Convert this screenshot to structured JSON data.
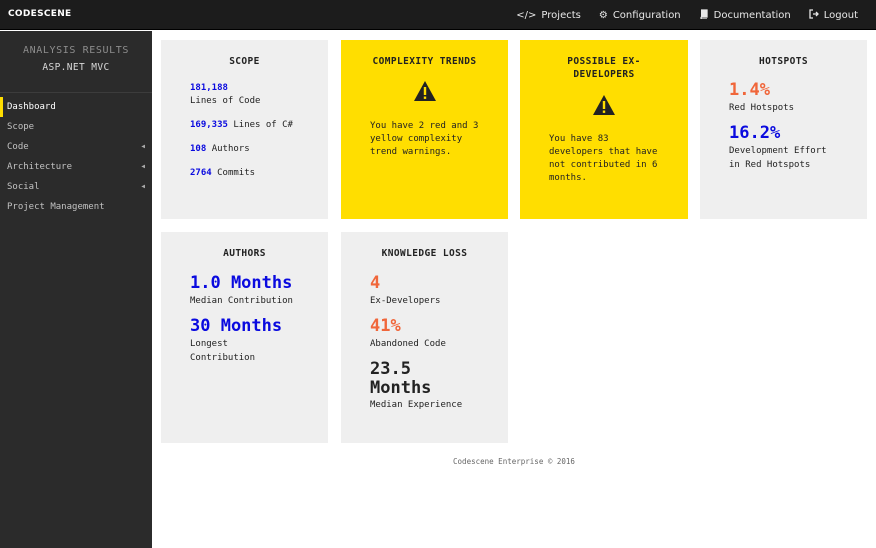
{
  "app": {
    "logo": "CODESCENE"
  },
  "topnav": {
    "projects": {
      "icon": "code-icon",
      "label": "Projects"
    },
    "configuration": {
      "icon": "gears-icon",
      "label": "Configuration"
    },
    "documentation": {
      "icon": "book-icon",
      "label": "Documentation"
    },
    "logout": {
      "icon": "logout-icon",
      "label": "Logout"
    }
  },
  "sidebar": {
    "label": "ANALYSIS RESULTS",
    "project": "ASP.NET MVC",
    "items": [
      {
        "label": "Dashboard",
        "active": true
      },
      {
        "label": "Scope"
      },
      {
        "label": "Code",
        "has_submenu": true
      },
      {
        "label": "Architecture",
        "has_submenu": true
      },
      {
        "label": "Social",
        "has_submenu": true
      },
      {
        "label": "Project Management"
      }
    ]
  },
  "cards": {
    "scope": {
      "title": "SCOPE",
      "lines_value": "181,188",
      "lines_label": "Lines of Code",
      "csharp_value": "169,335",
      "csharp_label": "Lines of C#",
      "authors_value": "108",
      "authors_label": "Authors",
      "commits_value": "2764",
      "commits_label": "Commits"
    },
    "complexity": {
      "title": "COMPLEXITY TRENDS",
      "icon": "warning-icon",
      "line1": "You have 2 red and 3",
      "line2": "yellow complexity",
      "line3": "trend warnings."
    },
    "exdevs": {
      "title_line1": "POSSIBLE EX-",
      "title_line2": "DEVELOPERS",
      "icon": "warning-icon",
      "line1": "You have 83",
      "line2": "developers that have",
      "line3": "not contributed in 6",
      "line4": "months."
    },
    "hotspots": {
      "title": "HOTSPOTS",
      "red_value": "1.4%",
      "red_label": "Red Hotspots",
      "effort_value": "16.2%",
      "effort_label1": "Development Effort",
      "effort_label2": "in Red Hotspots"
    },
    "authors": {
      "title": "AUTHORS",
      "median_value": "1.0 Months",
      "median_label": "Median Contribution",
      "longest_value": "30 Months",
      "longest_label1": "Longest",
      "longest_label2": "Contribution"
    },
    "knowledge": {
      "title": "KNOWLEDGE LOSS",
      "exdev_value": "4",
      "exdev_label": "Ex-Developers",
      "abandoned_value": "41%",
      "abandoned_label": "Abandoned Code",
      "experience_value1": "23.5",
      "experience_value2": "Months",
      "experience_label": "Median Experience"
    }
  },
  "footer": {
    "text": "Codescene Enterprise © 2016"
  },
  "colors": {
    "accent_yellow": "#ffde00",
    "blue": "#0a0adf",
    "red": "#f0663a",
    "topbar": "#1c1c1c",
    "sidebar": "#2b2b2b"
  }
}
